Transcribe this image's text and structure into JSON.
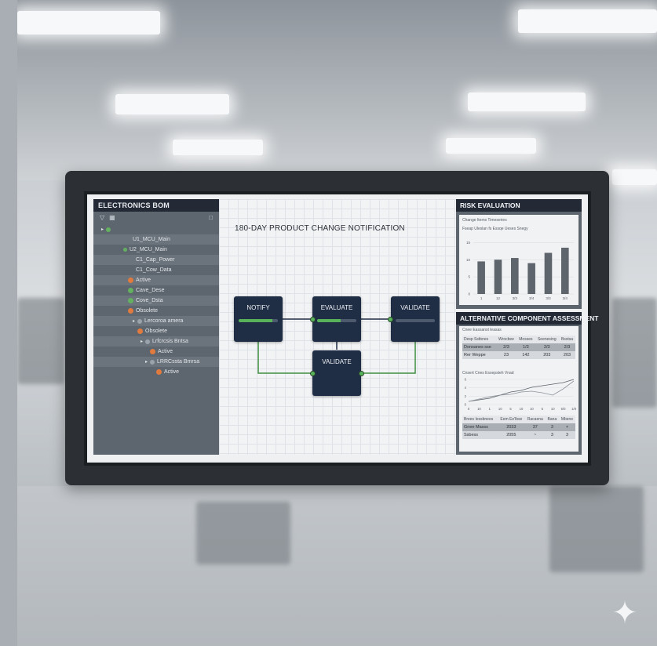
{
  "bom": {
    "title": "ELECTRONICS BOM",
    "items": [
      {
        "label": "U1_MCU_Main"
      },
      {
        "label": "U2_MCU_Main"
      },
      {
        "label": "C1_Cap_Power"
      },
      {
        "label": "C1_Cow_Data"
      },
      {
        "label": "Active"
      },
      {
        "label": "Cave_Dese"
      },
      {
        "label": "Cove_Dsta"
      },
      {
        "label": "Obsolete"
      },
      {
        "label": "Lercoroa amera"
      },
      {
        "label": "Obsolete"
      },
      {
        "label": "Lrfcrcsis Bntsa"
      },
      {
        "label": "Active"
      },
      {
        "label": "LRRCssta Bmrsa"
      },
      {
        "label": "Active"
      }
    ]
  },
  "canvas": {
    "title": "180-DAY PRODUCT CHANGE NOTIFICATION",
    "nodes": {
      "notify": {
        "label": "NOTIFY",
        "progress": 0.85
      },
      "evaluate": {
        "label": "EVALUATE",
        "progress": 0.6
      },
      "validate_right": {
        "label": "VALIDATE",
        "progress": 0
      },
      "validate_bottom": {
        "label": "VALIDATE"
      }
    }
  },
  "risk": {
    "title": "RISK EVALUATION",
    "subtitle": "Change Items Timeseries",
    "legend": "Fseap Uleslan fs  Essqe Ueses  Snegy",
    "chart_data": {
      "type": "bar",
      "categories": [
        "1",
        "12",
        "3/3",
        "3/4",
        "3/3",
        "3/4"
      ],
      "values": [
        9.5,
        10,
        10.5,
        9,
        12,
        13.5
      ],
      "ylim": [
        0,
        16
      ],
      "yticks": [
        "15",
        "10",
        "5",
        "0"
      ]
    }
  },
  "alt": {
    "title": "ALTERNATIVE COMPONENT ASSESSMENT",
    "subtitle": "Cnee Eassanst leasas",
    "table1": {
      "headers": [
        "Desp Sstbnes",
        "Wrocbee",
        "Mosses",
        "Seenesing",
        "Bsstsa"
      ],
      "rows": [
        [
          "Donsanes sse",
          "2/3",
          "1/3",
          "2/3",
          "2/3"
        ],
        [
          "Rer Weppe",
          "23",
          "142",
          "203",
          "203"
        ]
      ]
    },
    "line_title": "Cnsert Cnes Esxepsteh Vnad",
    "chart_data": {
      "type": "line",
      "x": [
        "0",
        "10",
        "1",
        "10",
        "5",
        "10",
        "10",
        "5",
        "10",
        "5/0",
        "1/8"
      ],
      "series": [
        {
          "values": [
            2,
            3,
            4,
            6,
            8,
            9,
            11,
            12,
            13,
            14,
            16
          ]
        },
        {
          "values": [
            2,
            3.5,
            5,
            6,
            6.5,
            8,
            8.5,
            7.5,
            6,
            10,
            15
          ]
        }
      ],
      "yticks": [
        "6",
        "4",
        "2",
        "0"
      ]
    },
    "table2": {
      "headers": [
        "Brees Iessbnees",
        "Eem Ee'lbse",
        "Racaena",
        "Bana",
        "Mbene"
      ],
      "rows": [
        [
          "Gnee Masss",
          "2033",
          "37",
          "3",
          "+"
        ],
        [
          "Ssbess",
          "2055",
          "~",
          "3",
          "3"
        ]
      ]
    }
  }
}
